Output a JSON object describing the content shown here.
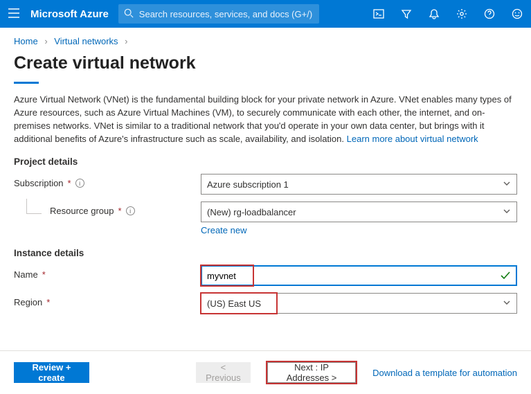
{
  "header": {
    "brand": "Microsoft Azure",
    "search_placeholder": "Search resources, services, and docs (G+/)"
  },
  "breadcrumb": {
    "home": "Home",
    "vnets": "Virtual networks"
  },
  "page": {
    "title": "Create virtual network",
    "intro_text": "Azure Virtual Network (VNet) is the fundamental building block for your private network in Azure. VNet enables many types of Azure resources, such as Azure Virtual Machines (VM), to securely communicate with each other, the internet, and on-premises networks. VNet is similar to a traditional network that you'd operate in your own data center, but brings with it additional benefits of Azure's infrastructure such as scale, availability, and isolation.  ",
    "learn_more": "Learn more about virtual network"
  },
  "sections": {
    "project": "Project details",
    "instance": "Instance details"
  },
  "form": {
    "subscription_label": "Subscription",
    "subscription_value": "Azure subscription 1",
    "rg_label": "Resource group",
    "rg_value": "(New) rg-loadbalancer",
    "rg_create_new": "Create new",
    "name_label": "Name",
    "name_value": "myvnet",
    "region_label": "Region",
    "region_value": "(US) East US"
  },
  "footer": {
    "review": "Review + create",
    "previous": "< Previous",
    "next": "Next : IP Addresses >",
    "download": "Download a template for automation"
  }
}
